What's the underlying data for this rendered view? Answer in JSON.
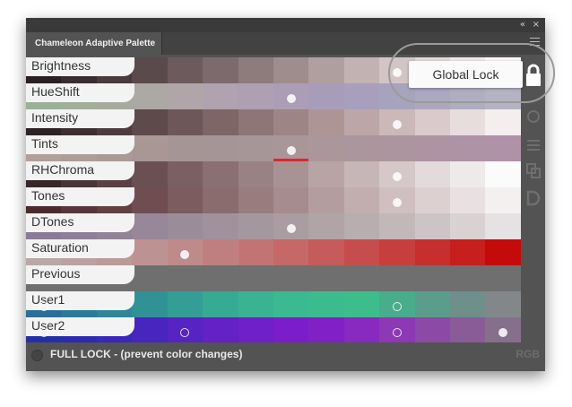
{
  "panel": {
    "tab_title": "Chameleon Adaptive Palette",
    "title_buttons": {
      "collapse": "«",
      "close": "×"
    }
  },
  "rows": [
    {
      "label": "Brightness",
      "colors": [
        "#2a2023",
        "#3a2d2f",
        "#4a3a3c",
        "#5b4a4c",
        "#6c5a5c",
        "#7d6a6c",
        "#8e7c7d",
        "#9f8d8e",
        "#b09f9f",
        "#c2b2b2",
        "#d3c5c5",
        "#e3d8d8",
        "#f0e8e8",
        "#fbf6f6"
      ],
      "markers": [
        {
          "type": "filled",
          "col": 10
        }
      ]
    },
    {
      "label": "HueShift",
      "colors": [
        "#9bb09a",
        "#a0ae9b",
        "#a7ab9f",
        "#aca8a3",
        "#b0a5a8",
        "#b0a2ae",
        "#ae9fb2",
        "#ab9db5",
        "#a89db8",
        "#a79fbb",
        "#a8a3bd",
        "#aba8bf",
        "#afaec1",
        "#b3b3c3"
      ],
      "markers": [
        {
          "type": "filled",
          "col": 7
        }
      ]
    },
    {
      "label": "Intensity",
      "colors": [
        "#2d2224",
        "#3e2e30",
        "#4e3b3d",
        "#5e494b",
        "#6e5759",
        "#7e6667",
        "#8e7576",
        "#9d8586",
        "#ad9596",
        "#bca6a7",
        "#cbb8b9",
        "#dacacb",
        "#e8dddd",
        "#f4eeee"
      ],
      "markers": [
        {
          "type": "filled",
          "col": 10
        }
      ]
    },
    {
      "label": "Tints",
      "colors": [
        "#b0a098",
        "#ad9d97",
        "#aa9a96",
        "#a89795",
        "#a69595",
        "#a69596",
        "#a79697",
        "#a99699",
        "#aa969b",
        "#ac969e",
        "#ad95a0",
        "#ae93a3",
        "#ae92a5",
        "#af91a8"
      ],
      "markers": [
        {
          "type": "filled",
          "col": 7
        }
      ],
      "underline_col": 7
    },
    {
      "label": "RHChroma",
      "colors": [
        "#3a2629",
        "#4a3336",
        "#5a4144",
        "#6a5053",
        "#7a6062",
        "#8a7072",
        "#9a8183",
        "#a99294",
        "#b8a3a5",
        "#c7b6b7",
        "#d6c8c9",
        "#e3dadb",
        "#eeeaea",
        "#fbfbfb"
      ],
      "markers": [
        {
          "type": "filled",
          "col": 10
        }
      ]
    },
    {
      "label": "Tones",
      "colors": [
        "#4a2a2e",
        "#56363a",
        "#623f43",
        "#6f4d51",
        "#7c5c5f",
        "#8a6b6e",
        "#987c7e",
        "#a68c8e",
        "#b49d9f",
        "#c2aeaf",
        "#cfbfc0",
        "#dcd0d1",
        "#e9e1e1",
        "#f5f0f0"
      ],
      "markers": [
        {
          "type": "filled",
          "col": 10
        }
      ]
    },
    {
      "label": "DTones",
      "colors": [
        "#8a7a96",
        "#8e7e97",
        "#938398",
        "#978799",
        "#9b8c9a",
        "#a0919c",
        "#a5979e",
        "#aa9da1",
        "#b0a4a6",
        "#b8adaf",
        "#c2b8ba",
        "#ccc4c6",
        "#d9d2d3",
        "#e6e1e2"
      ],
      "markers": [
        {
          "type": "filled",
          "col": 7
        }
      ]
    },
    {
      "label": "Saturation",
      "colors": [
        "#b8a8a8",
        "#b9a1a1",
        "#bb9a9a",
        "#bd9292",
        "#bf8a8a",
        "#c07f7f",
        "#c27474",
        "#c46868",
        "#c55b5b",
        "#c64d4d",
        "#c73e3e",
        "#c72f2f",
        "#c71e1e",
        "#c40a0a"
      ],
      "markers": [
        {
          "type": "filled",
          "col": 4
        }
      ]
    },
    {
      "label": "Previous",
      "colors": [
        "#6f6f6f",
        "#6f6f6f",
        "#6f6f6f",
        "#6f6f6f",
        "#6f6f6f",
        "#6f6f6f",
        "#6f6f6f",
        "#6f6f6f",
        "#6f6f6f",
        "#6f6f6f",
        "#6f6f6f",
        "#6f6f6f",
        "#6f6f6f",
        "#6f6f6f"
      ],
      "markers": []
    },
    {
      "label": "User1",
      "colors": [
        "#2a6e9c",
        "#2c7a9a",
        "#2e8698",
        "#319296",
        "#349e95",
        "#37aa93",
        "#39b392",
        "#3bb990",
        "#3cbc8e",
        "#3dbd8c",
        "#47ad8b",
        "#5a9d8b",
        "#6f8f8b",
        "#83878a"
      ],
      "markers": [
        {
          "type": "ring",
          "col": 0
        },
        {
          "type": "ring",
          "col": 10
        }
      ]
    },
    {
      "label": "User2",
      "colors": [
        "#232fa8",
        "#2b2ab3",
        "#3927ba",
        "#4825bf",
        "#5723c2",
        "#6421c5",
        "#7020c8",
        "#7b1ec9",
        "#8020c5",
        "#8829bf",
        "#8d38b4",
        "#8c4aa6",
        "#895c98",
        "#866f8a"
      ],
      "markers": [
        {
          "type": "ring",
          "col": 0
        },
        {
          "type": "ring",
          "col": 4
        },
        {
          "type": "ring",
          "col": 10
        },
        {
          "type": "filled",
          "col": 13
        }
      ]
    }
  ],
  "global_lock": {
    "label": "Global Lock"
  },
  "footer": {
    "full_lock_label": "FULL LOCK - (prevent color changes)",
    "mode_label": "RGB"
  }
}
